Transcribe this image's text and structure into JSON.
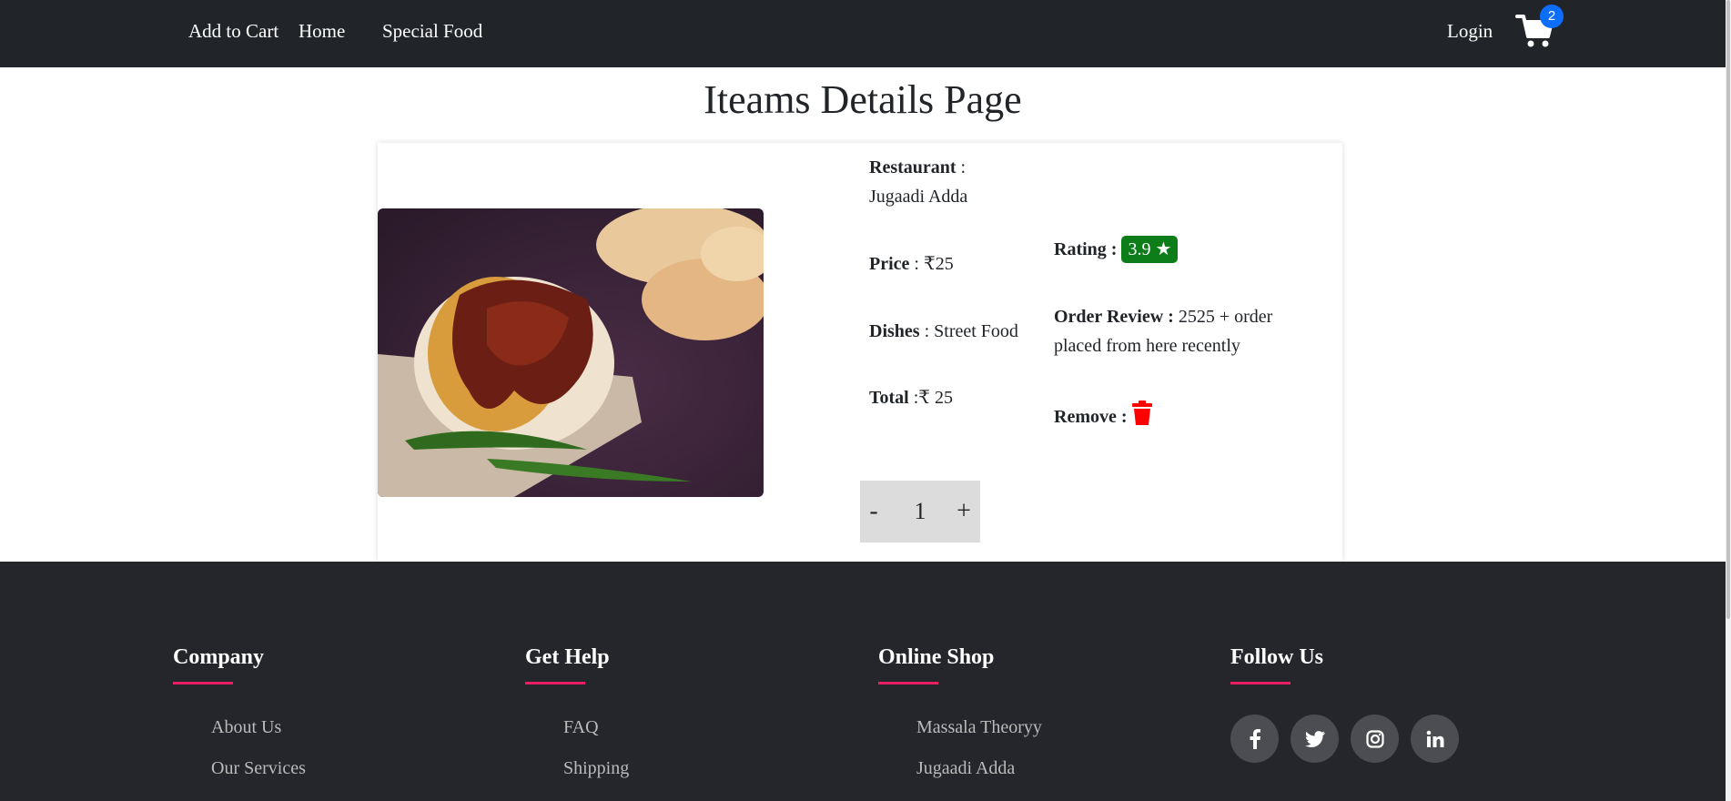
{
  "navbar": {
    "brand": "Add to Cart",
    "links": [
      "Home",
      "Special Food"
    ],
    "login": "Login",
    "cart_count": "2"
  },
  "page": {
    "title": "Iteams Details Page"
  },
  "item": {
    "restaurant_label": "Restaurant",
    "restaurant_sep": " :",
    "restaurant": "Jugaadi Adda",
    "price_label": "Price",
    "price": " : ₹25",
    "rating_label": "Rating :",
    "rating": "3.9 ★",
    "dishes_label": "Dishes",
    "dishes": " : Street Food",
    "order_review_label": "Order Review :",
    "order_review_line1": " 2525 + order",
    "order_review_line2": "placed from here recently",
    "total_label": "Total",
    "total": " :₹ 25",
    "remove_label": "Remove :",
    "quantity": "1",
    "decrement": "-",
    "increment": "+"
  },
  "footer": {
    "columns": [
      {
        "heading": "Company",
        "links": [
          "About Us",
          "Our Services"
        ]
      },
      {
        "heading": "Get Help",
        "links": [
          "FAQ",
          "Shipping"
        ]
      },
      {
        "heading": "Online Shop",
        "links": [
          "Massala Theoryy",
          "Jugaadi Adda"
        ]
      },
      {
        "heading": "Follow Us",
        "links": []
      }
    ],
    "social_icons": [
      "facebook-icon",
      "twitter-icon",
      "instagram-icon",
      "linkedin-icon"
    ]
  },
  "colors": {
    "navbar_bg": "#212529",
    "footer_bg": "#24262b",
    "accent_underline": "#e91e63",
    "rating_badge": "#0d7d1a",
    "cart_badge": "#0d6efd",
    "trash": "#ff0000"
  }
}
